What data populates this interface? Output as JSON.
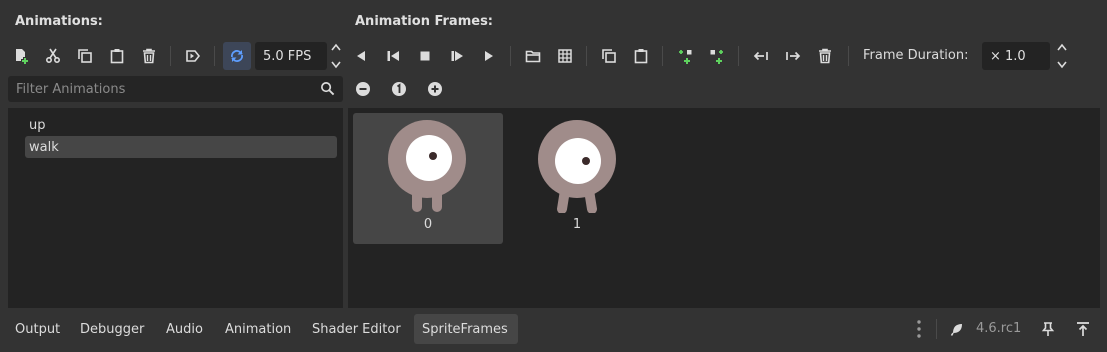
{
  "left_panel": {
    "heading": "Animations:",
    "fps": "5.0 FPS",
    "filter_placeholder": "Filter Animations",
    "animations": [
      "up",
      "walk"
    ],
    "selected_animation": "walk"
  },
  "right_panel": {
    "heading": "Animation Frames:",
    "frame_duration_label": "Frame Duration:",
    "frame_duration_value": "× 1.0",
    "frames": [
      "0",
      "1"
    ],
    "selected_frame": "0"
  },
  "bottom_tabs": [
    "Output",
    "Debugger",
    "Audio",
    "Animation",
    "Shader Editor",
    "SpriteFrames"
  ],
  "active_tab": "SpriteFrames",
  "version": "4.6.rc1",
  "colors": {
    "accent": "#5e9eff",
    "add_green": "#5fd35f",
    "sprite_body": "#a08c8a",
    "selected_bg": "#464646"
  }
}
